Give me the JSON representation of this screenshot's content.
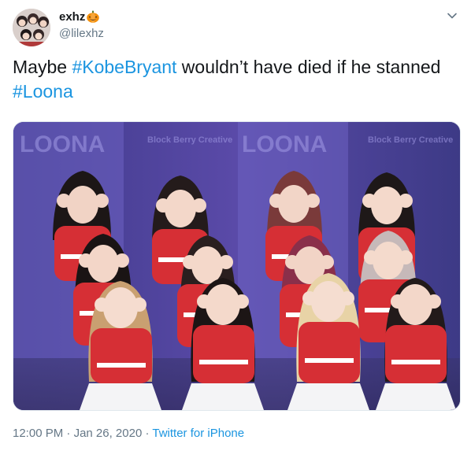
{
  "author": {
    "display_name": "exhz",
    "handle": "@lilexhz",
    "name_emoji": "pumpkin-icon"
  },
  "tweet": {
    "text_before": "Maybe ",
    "hashtag_1": "#KobeBryant",
    "text_middle": " wouldn’t have died if he stanned ",
    "hashtag_2": "#Loona"
  },
  "media": {
    "description_icon": "group-photo-image",
    "backdrop_text_1": "LOONA",
    "backdrop_text_2": "Block Berry Creative",
    "accent_colors": [
      "#4b3f97",
      "#d62f35",
      "#ffffff"
    ]
  },
  "meta": {
    "time": "12:00 PM",
    "separator": " · ",
    "date": "Jan 26, 2020",
    "source": "Twitter for iPhone"
  }
}
